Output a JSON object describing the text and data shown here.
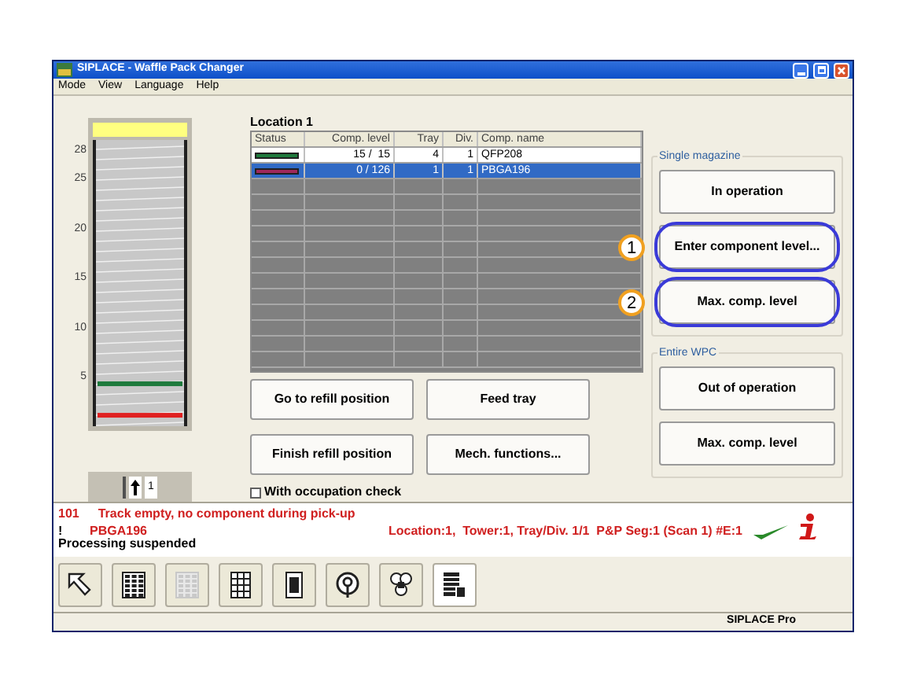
{
  "window": {
    "title": "SIPLACE - Waffle Pack Changer"
  },
  "menu": [
    "Mode",
    "View",
    "Language",
    "Help"
  ],
  "magazine": {
    "scale": [
      "28",
      "25",
      "20",
      "15",
      "10",
      "5"
    ],
    "tray_lines": [
      {
        "color": "#1e7a3c",
        "level": 0.14
      },
      {
        "color": "#e02020",
        "level": 0.03
      }
    ],
    "tower_indicator": "1"
  },
  "location": {
    "title": "Location 1"
  },
  "table": {
    "columns": [
      "Status",
      "Comp. level",
      "Tray",
      "Div.",
      "Comp. name"
    ],
    "rows": [
      {
        "color": "#1e7a3c",
        "level": "15 /  15",
        "tray": "4",
        "div": "1",
        "name": "QFP208",
        "selected": false
      },
      {
        "color": "#a0285a",
        "level": "0 / 126",
        "tray": "1",
        "div": "1",
        "name": "PBGA196",
        "selected": true
      }
    ]
  },
  "actions": [
    "Go to refill position",
    "Feed tray",
    "Finish refill position",
    "Mech. functions..."
  ],
  "occupation_check": {
    "label": "With occupation check",
    "checked": false
  },
  "groups": [
    {
      "title": "Single magazine",
      "buttons": [
        {
          "label": "In operation",
          "highlighted": false
        },
        {
          "label": "Enter component level...",
          "highlighted": true,
          "marker": "1"
        },
        {
          "label": "Max. comp. level",
          "highlighted": true,
          "marker": "2"
        }
      ]
    },
    {
      "title": "Entire WPC",
      "buttons": [
        {
          "label": "Out of operation",
          "highlighted": false
        },
        {
          "label": "Max. comp. level",
          "highlighted": false
        }
      ]
    }
  ],
  "message": {
    "code": "101",
    "text": "Track empty, no component during pick-up",
    "icon": "!",
    "component": "PBGA196",
    "location": "Location:1,  Tower:1, Tray/Div. 1/1  P&P Seg:1 (Scan 1) #E:1",
    "status": "Processing suspended"
  },
  "toolbar": [
    {
      "kind": "pointer",
      "disabled": false,
      "selected": false
    },
    {
      "kind": "magazine",
      "disabled": false,
      "selected": false
    },
    {
      "kind": "magazine",
      "disabled": true,
      "selected": false
    },
    {
      "kind": "grid",
      "disabled": false,
      "selected": false
    },
    {
      "kind": "tray",
      "disabled": false,
      "selected": false
    },
    {
      "kind": "nozzle",
      "disabled": false,
      "selected": false
    },
    {
      "kind": "recycle",
      "disabled": false,
      "selected": false
    },
    {
      "kind": "list",
      "disabled": false,
      "selected": true
    }
  ],
  "status_bar": "SIPLACE Pro"
}
